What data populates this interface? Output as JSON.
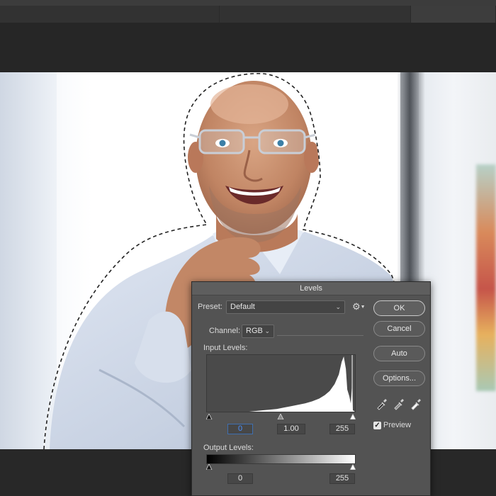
{
  "dialog": {
    "title": "Levels",
    "preset_label": "Preset:",
    "preset_value": "Default",
    "channel_label": "Channel:",
    "channel_value": "RGB",
    "input_levels_label": "Input Levels:",
    "input_black": "0",
    "input_mid": "1.00",
    "input_white": "255",
    "output_levels_label": "Output Levels:",
    "output_black": "0",
    "output_white": "255",
    "buttons": {
      "ok": "OK",
      "cancel": "Cancel",
      "auto": "Auto",
      "options": "Options..."
    },
    "preview_label": "Preview",
    "preview_checked": true
  },
  "icons": {
    "gear": "gear-icon",
    "black_eyedropper": "black-point-eyedropper-icon",
    "gray_eyedropper": "gray-point-eyedropper-icon",
    "white_eyedropper": "white-point-eyedropper-icon",
    "check": "✓"
  }
}
